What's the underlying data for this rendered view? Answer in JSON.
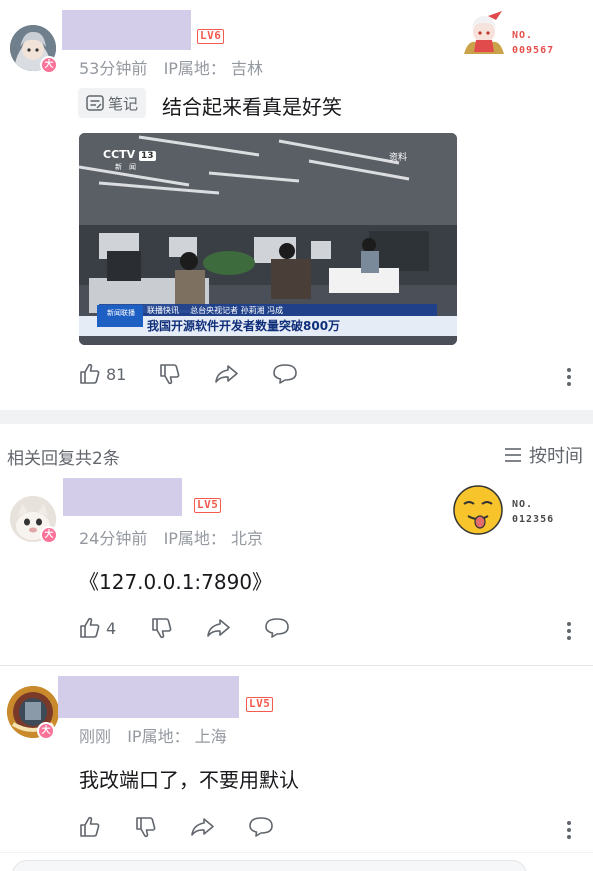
{
  "comment_main": {
    "lv": "LV6",
    "time": "53分钟前",
    "ip_label": "IP属地：",
    "ip_value": "吉林",
    "note_tag": "笔记",
    "text": "结合起来看真是好笑",
    "likes": "81",
    "badge": "大",
    "fan_no_label": "NO.",
    "fan_no": "009567",
    "image": {
      "logo": "CCTV",
      "channel": "13",
      "channel_sub": "新　闻",
      "tag": "资料",
      "news_label": "联播快讯",
      "reporter": "总台央视记者 孙莉湘 冯成",
      "headline": "我国开源软件开发者数量突破800万",
      "corner_logo": "新闻联播"
    }
  },
  "replies_header": {
    "count_text": "相关回复共2条",
    "sort_label": "按时间"
  },
  "reply_1": {
    "lv": "LV5",
    "time": "24分钟前",
    "ip_label": "IP属地：",
    "ip_value": "北京",
    "text": "《127.0.0.1:7890》",
    "likes": "4",
    "badge": "大",
    "fan_no_label": "NO.",
    "fan_no": "012356"
  },
  "reply_2": {
    "lv": "LV5",
    "time": "刚刚",
    "ip_label": "IP属地：",
    "ip_value": "上海",
    "text": "我改端口了，不要用默认",
    "likes": "",
    "badge": "大"
  },
  "colors": {
    "accent_pink": "#fb7299",
    "level_red": "#f45a4e",
    "meta_grey": "#9499a0",
    "placeholder_block": "#d4cde9"
  }
}
